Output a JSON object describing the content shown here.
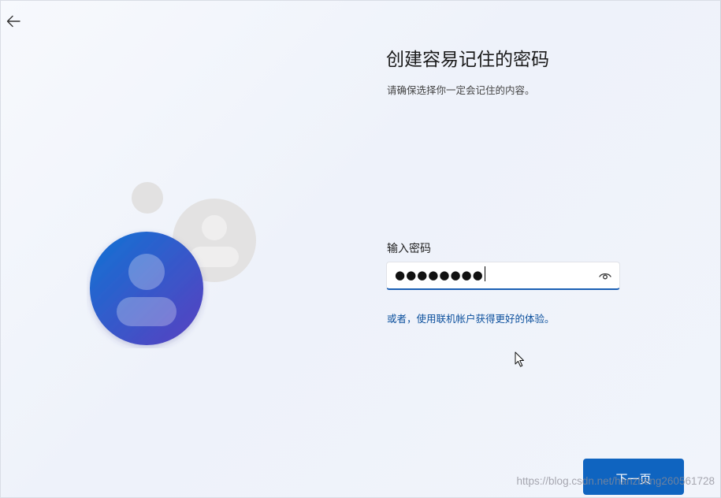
{
  "header": {
    "back_icon": "arrow-left-icon"
  },
  "content": {
    "title": "创建容易记住的密码",
    "subtitle": "请确保选择你一定会记住的内容。"
  },
  "password": {
    "label": "输入密码",
    "masked_value": "●●●●●●●●",
    "reveal_icon": "eye-icon"
  },
  "links": {
    "online_account": "或者，使用联机帐户获得更好的体验。"
  },
  "footer": {
    "next_label": "下一页"
  },
  "watermark": {
    "text": "https://blog.csdn.net/hanzheng260561728"
  },
  "colors": {
    "accent": "#0f64c0",
    "link": "#0b4f9c",
    "avatar_gradient_start": "#1173d4",
    "avatar_gradient_end": "#5a3fc0"
  }
}
